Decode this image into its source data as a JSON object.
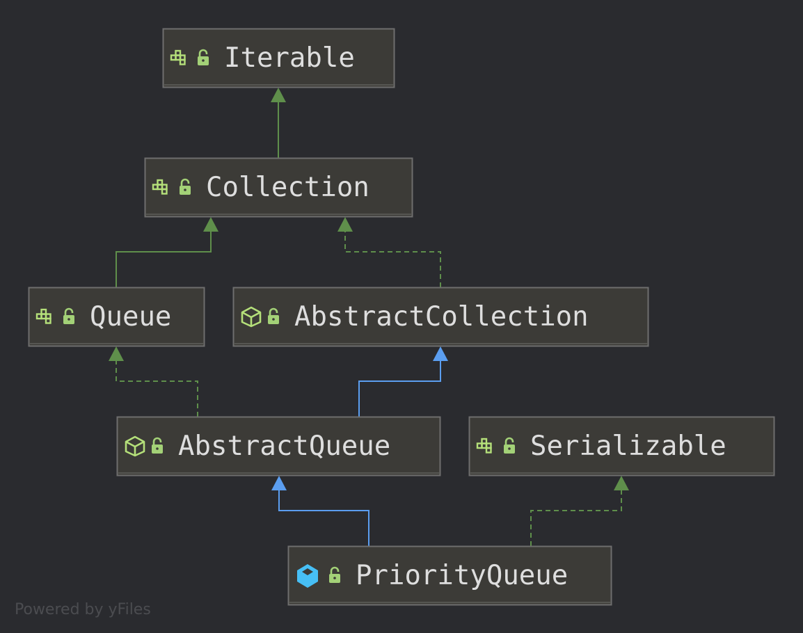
{
  "diagram": {
    "nodes": [
      {
        "id": "iterable",
        "label": "Iterable",
        "kind": "interface",
        "access": "public"
      },
      {
        "id": "collection",
        "label": "Collection",
        "kind": "interface",
        "access": "public"
      },
      {
        "id": "queue",
        "label": "Queue",
        "kind": "interface",
        "access": "public"
      },
      {
        "id": "abstractcollection",
        "label": "AbstractCollection",
        "kind": "abstract-class",
        "access": "public"
      },
      {
        "id": "abstractqueue",
        "label": "AbstractQueue",
        "kind": "abstract-class",
        "access": "public"
      },
      {
        "id": "serializable",
        "label": "Serializable",
        "kind": "interface",
        "access": "public"
      },
      {
        "id": "priorityqueue",
        "label": "PriorityQueue",
        "kind": "class",
        "access": "public"
      }
    ],
    "edges": [
      {
        "from": "collection",
        "to": "iterable",
        "type": "extends-interface"
      },
      {
        "from": "queue",
        "to": "collection",
        "type": "extends-interface"
      },
      {
        "from": "abstractcollection",
        "to": "collection",
        "type": "implements"
      },
      {
        "from": "abstractqueue",
        "to": "queue",
        "type": "implements"
      },
      {
        "from": "abstractqueue",
        "to": "abstractcollection",
        "type": "extends-class"
      },
      {
        "from": "priorityqueue",
        "to": "abstractqueue",
        "type": "extends-class"
      },
      {
        "from": "priorityqueue",
        "to": "serializable",
        "type": "implements"
      }
    ]
  },
  "colors": {
    "background": "#2a2b2f",
    "node_fill": "#3c3b37",
    "node_border": "#6e6e6e",
    "interface_edge": "#5f8f4b",
    "class_edge": "#5b9ef0",
    "interface_icon": "#b5e07a",
    "class_icon": "#47bff5",
    "lock_icon": "#a3d177"
  },
  "footer": "Powered by yFiles"
}
